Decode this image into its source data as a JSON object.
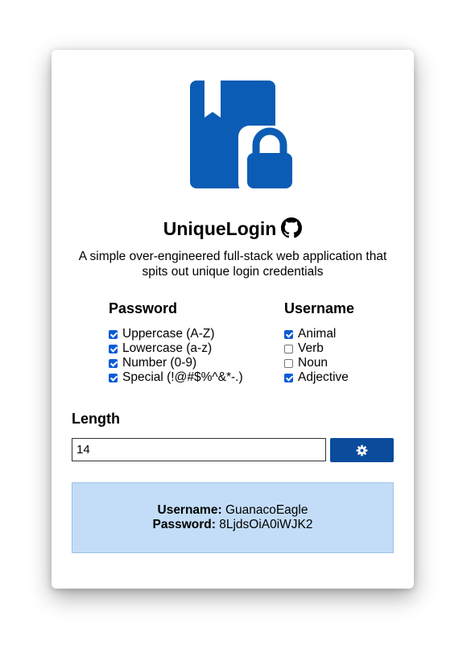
{
  "app": {
    "title": "UniqueLogin",
    "subtitle": "A simple over-engineered full-stack web application that spits out unique login credentials",
    "logo_icon": "bookmark-lock-icon",
    "github_icon": "github-icon",
    "accent_color": "#0b5cb4"
  },
  "password": {
    "heading": "Password",
    "options": [
      {
        "label": "Uppercase (A-Z)",
        "checked": true
      },
      {
        "label": "Lowercase (a-z)",
        "checked": true
      },
      {
        "label": "Number (0-9)",
        "checked": true
      },
      {
        "label": "Special (!@#$%^&*-.)",
        "checked": true
      }
    ]
  },
  "username": {
    "heading": "Username",
    "options": [
      {
        "label": "Animal",
        "checked": true
      },
      {
        "label": "Verb",
        "checked": false
      },
      {
        "label": "Noun",
        "checked": false
      },
      {
        "label": "Adjective",
        "checked": true
      }
    ]
  },
  "length": {
    "label": "Length",
    "value": "14"
  },
  "generate_button": {
    "icon": "gear-icon",
    "color": "#0b4b9c"
  },
  "result": {
    "username_label": "Username:",
    "username_value": "GuanacoEagle",
    "password_label": "Password:",
    "password_value": "8LjdsOiA0iWJK2"
  }
}
